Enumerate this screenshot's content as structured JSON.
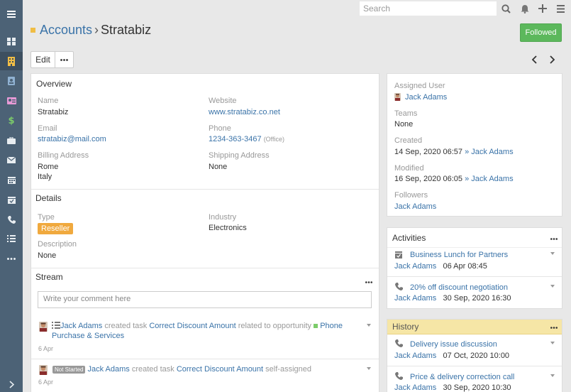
{
  "sidebar": {
    "items": [
      {
        "icon": "hamburger-icon"
      },
      {
        "icon": "dashboard-icon"
      },
      {
        "icon": "building-icon",
        "active": true
      },
      {
        "icon": "contact-card-icon"
      },
      {
        "icon": "lead-card-icon"
      },
      {
        "icon": "dollar-icon"
      },
      {
        "icon": "briefcase-icon"
      },
      {
        "icon": "envelope-icon"
      },
      {
        "icon": "calendar-icon"
      },
      {
        "icon": "calendar-check-icon"
      },
      {
        "icon": "phone-icon"
      },
      {
        "icon": "tasks-icon"
      },
      {
        "icon": "more-icon"
      },
      {
        "icon": "chevron-right-icon"
      }
    ]
  },
  "topbar": {
    "search_placeholder": "Search"
  },
  "header": {
    "parent": "Accounts",
    "separator": "›",
    "current": "Stratabiz",
    "followed_label": "Followed"
  },
  "toolbar": {
    "edit_label": "Edit"
  },
  "overview": {
    "title": "Overview",
    "name_label": "Name",
    "name_value": "Stratabiz",
    "website_label": "Website",
    "website_value": "www.stratabiz.co.net",
    "email_label": "Email",
    "email_value": "stratabiz@mail.com",
    "phone_label": "Phone",
    "phone_value": "1234-363-3467",
    "phone_type": "(Office)",
    "billing_label": "Billing Address",
    "billing_line1": "Rome",
    "billing_line2": "Italy",
    "shipping_label": "Shipping Address",
    "shipping_value": "None"
  },
  "details": {
    "title": "Details",
    "type_label": "Type",
    "type_value": "Reseller",
    "industry_label": "Industry",
    "industry_value": "Electronics",
    "description_label": "Description",
    "description_value": "None"
  },
  "stream": {
    "title": "Stream",
    "comment_placeholder": "Write your comment here",
    "entries": [
      {
        "user": "Jack Adams",
        "action": "created task",
        "target": "Correct Discount Amount",
        "relation": "related to opportunity",
        "related": "Phone Purchase & Services",
        "date": "6 Apr"
      },
      {
        "status": "Not Started",
        "user": "Jack Adams",
        "action": "created task",
        "target": "Correct Discount Amount",
        "relation": "self-assigned",
        "date": "6 Apr"
      }
    ]
  },
  "side": {
    "assigned_label": "Assigned User",
    "assigned_value": "Jack Adams",
    "teams_label": "Teams",
    "teams_value": "None",
    "created_label": "Created",
    "created_value": "14 Sep, 2020 06:57",
    "created_by": "» Jack Adams",
    "modified_label": "Modified",
    "modified_value": "16 Sep, 2020 06:05",
    "modified_by": "» Jack Adams",
    "followers_label": "Followers",
    "followers_value": "Jack Adams"
  },
  "activities": {
    "title": "Activities",
    "items": [
      {
        "title": "Business Lunch for Partners",
        "user": "Jack Adams",
        "date": "06 Apr 08:45",
        "icon": "calendar-icon"
      },
      {
        "title": "20% off discount negotiation",
        "user": "Jack Adams",
        "date": "30 Sep, 2020 16:30",
        "icon": "phone-icon"
      }
    ]
  },
  "history": {
    "title": "History",
    "items": [
      {
        "title": "Delivery issue discussion",
        "user": "Jack Adams",
        "date": "07 Oct, 2020 10:00",
        "icon": "phone-icon"
      },
      {
        "title": "Price & delivery correction call",
        "user": "Jack Adams",
        "date": "30 Sep, 2020 10:30",
        "icon": "phone-icon"
      }
    ]
  },
  "colors": {
    "sidebar": "#4c6276",
    "link": "#3a73a8",
    "followed": "#5cb85c",
    "reseller": "#f0a93e",
    "history_header": "#f6e6a6"
  }
}
